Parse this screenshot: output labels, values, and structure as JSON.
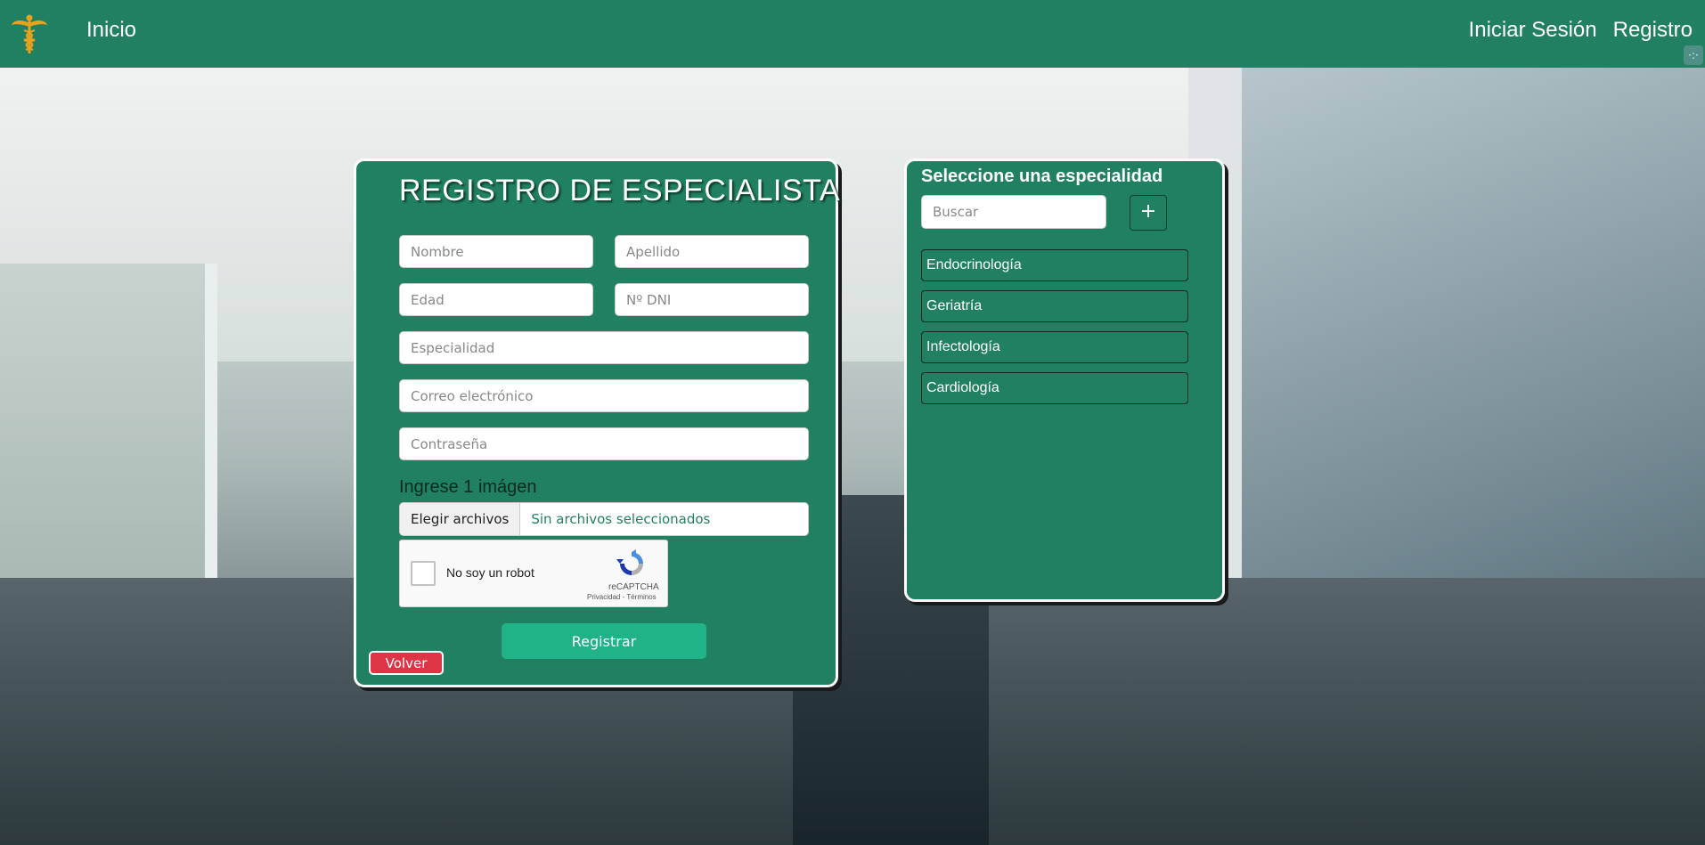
{
  "navbar": {
    "home": "Inicio",
    "login": "Iniciar Sesión",
    "register": "Registro"
  },
  "registration": {
    "title": "REGISTRO DE ESPECIALISTA",
    "fields": {
      "first_name": "Nombre",
      "last_name": "Apellido",
      "age": "Edad",
      "dni": "Nº DNI",
      "specialty": "Especialidad",
      "email": "Correo electrónico",
      "password": "Contraseña"
    },
    "image_label": "Ingrese 1 imágen",
    "file_button": "Elegir archivos",
    "file_status": "Sin archivos seleccionados",
    "captcha": {
      "label": "No soy un robot",
      "brand": "reCAPTCHA",
      "links": "Privacidad - Términos"
    },
    "submit": "Registrar",
    "back": "Volver"
  },
  "specialties": {
    "title": "Seleccione una especialidad",
    "search_placeholder": "Buscar",
    "add_label": "+",
    "items": [
      "Endocrinología",
      "Geriatría",
      "Infectología",
      "Cardiología"
    ]
  },
  "colors": {
    "primary": "#218062",
    "submit": "#20b387",
    "danger": "#dc3545"
  }
}
